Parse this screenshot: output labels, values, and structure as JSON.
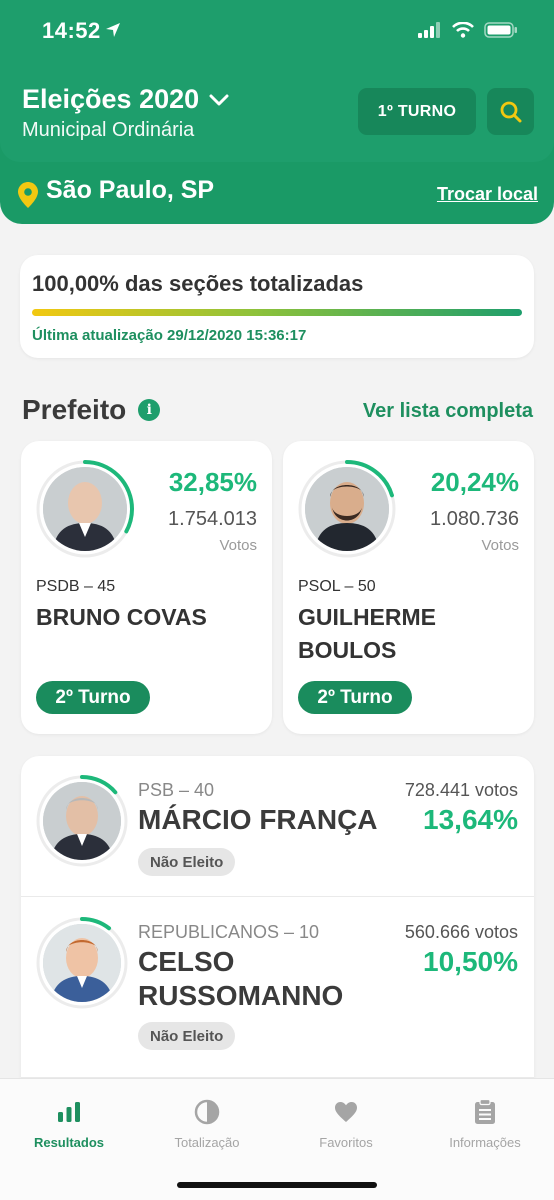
{
  "status_bar": {
    "time": "14:52"
  },
  "header": {
    "title": "Eleições 2020",
    "subtitle": "Municipal Ordinária",
    "turno_button": "1º TURNO",
    "location": "São Paulo, SP",
    "change_location": "Trocar local"
  },
  "progress": {
    "title": "100,00% das seções totalizadas",
    "percent": 100,
    "updated": "Última atualização 29/12/2020 15:36:17"
  },
  "section": {
    "title": "Prefeito",
    "see_all": "Ver lista completa"
  },
  "top_candidates": [
    {
      "pct": "32,85%",
      "votes": "1.754.013",
      "votes_label": "Votos",
      "party": "PSDB – 45",
      "name": "BRUNO COVAS",
      "status": "2º Turno",
      "ring_fraction": 0.3285
    },
    {
      "pct": "20,24%",
      "votes": "1.080.736",
      "votes_label": "Votos",
      "party": "PSOL – 50",
      "name": "GUILHERME BOULOS",
      "status": "2º Turno",
      "ring_fraction": 0.2024
    }
  ],
  "list_candidates": [
    {
      "party": "PSB – 40",
      "name": "MÁRCIO FRANÇA",
      "votes": "728.441 votos",
      "pct": "13,64%",
      "status": "Não Eleito",
      "ring_fraction": 0.1364
    },
    {
      "party": "REPUBLICANOS – 10",
      "name": "CELSO RUSSOMANNO",
      "votes": "560.666 votos",
      "pct": "10,50%",
      "status": "Não Eleito",
      "ring_fraction": 0.105
    }
  ],
  "tabs": [
    {
      "label": "Resultados",
      "icon": "bar-chart-icon",
      "active": true
    },
    {
      "label": "Totalização",
      "icon": "pie-chart-icon",
      "active": false
    },
    {
      "label": "Favoritos",
      "icon": "heart-icon",
      "active": false
    },
    {
      "label": "Informações",
      "icon": "clipboard-icon",
      "active": false
    }
  ],
  "colors": {
    "primary": "#1e9e6c",
    "accent_green": "#1db87a",
    "gold": "#f2c811"
  }
}
